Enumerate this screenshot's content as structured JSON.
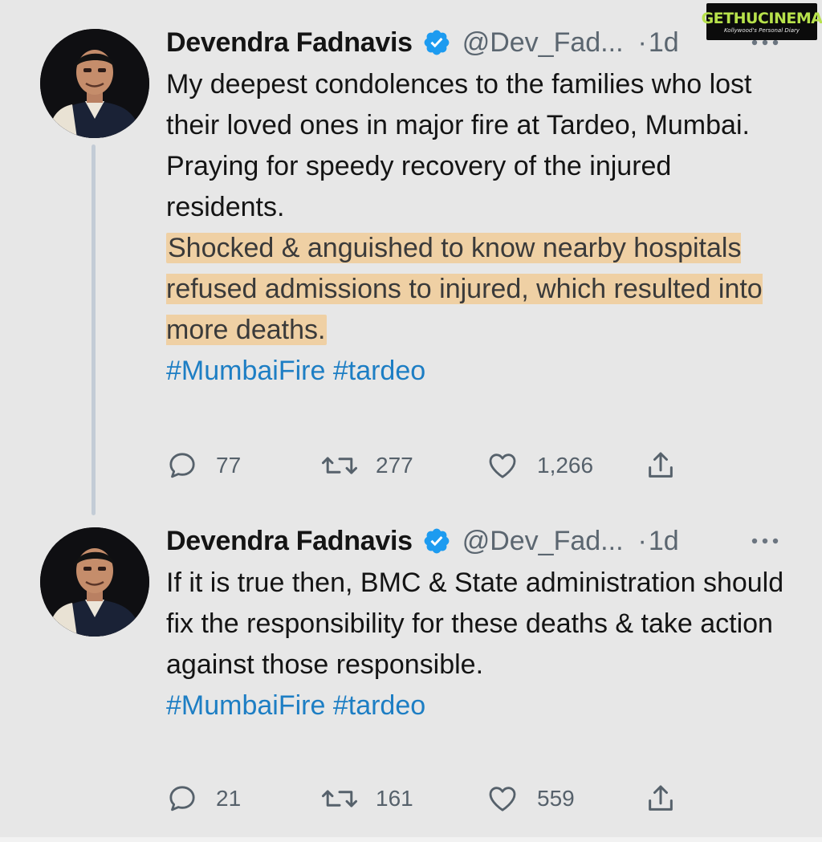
{
  "watermark": {
    "brand": "GETHUCINEMA",
    "tagline": "Kollywood's Personal Diary"
  },
  "colors": {
    "background": "#e7e7e7",
    "text": "#141414",
    "secondary_text": "#5b6670",
    "hashtag": "#1d7ec4",
    "verified_badge": "#1d9bf0",
    "highlight": "#f5be6e",
    "thread_line": "#c3ccd6"
  },
  "tweets": [
    {
      "author": {
        "name": "Devendra Fadnavis",
        "handle": "@Dev_Fad...",
        "verified_icon": "verified-badge-icon"
      },
      "time_separator": "·",
      "timestamp": "1d",
      "body": {
        "line1": "My deepest condolences to the families who lost their loved ones in major fire at Tardeo, Mumbai.",
        "line2": "Praying for speedy recovery of the injured residents.",
        "line3_highlighted": "Shocked & anguished to know nearby hospitals refused admissions to injured, which resulted into more deaths.",
        "hashtags": "#MumbaiFire #tardeo"
      },
      "stats": {
        "replies": "77",
        "retweets": "277",
        "likes": "1,266"
      }
    },
    {
      "author": {
        "name": "Devendra Fadnavis",
        "handle": "@Dev_Fad...",
        "verified_icon": "verified-badge-icon"
      },
      "time_separator": "·",
      "timestamp": "1d",
      "body": {
        "line1": "If it is true then, BMC & State administration should fix the responsibility for these deaths & take action against those responsible.",
        "hashtags": "#MumbaiFire #tardeo"
      },
      "stats": {
        "replies": "21",
        "retweets": "161",
        "likes": "559"
      }
    }
  ]
}
